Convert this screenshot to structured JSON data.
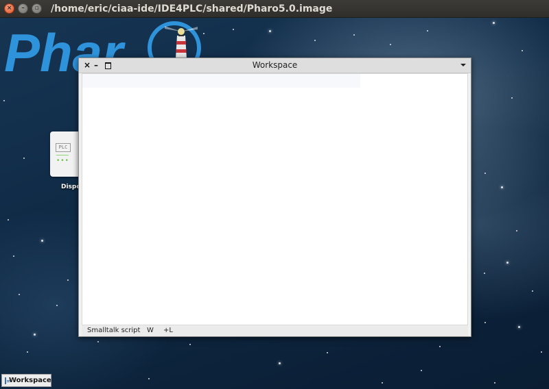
{
  "os_window": {
    "title": "/home/eric/ciaa-ide/IDE4PLC/shared/Pharo5.0.image",
    "close_glyph": "×",
    "minimize_glyph": "–",
    "maximize_glyph": "▫"
  },
  "desktop": {
    "logo_text": "Phar",
    "icon": {
      "badge_text": "PLC",
      "dots": "•••",
      "label": "Dispo"
    }
  },
  "workspace": {
    "title": "Workspace",
    "close_glyph": "×",
    "minimize_glyph": "–",
    "editor_content": "",
    "status": {
      "mode": "Smalltalk script",
      "w": "W",
      "line_toggle": "+L"
    }
  },
  "taskbar": {
    "items": [
      {
        "label": "Workspace",
        "icon": "workspace-icon"
      }
    ]
  },
  "colors": {
    "logo_blue": "#2f93db",
    "ubuntu_close": "#e0542b",
    "title_bar": "#3c3b37"
  }
}
